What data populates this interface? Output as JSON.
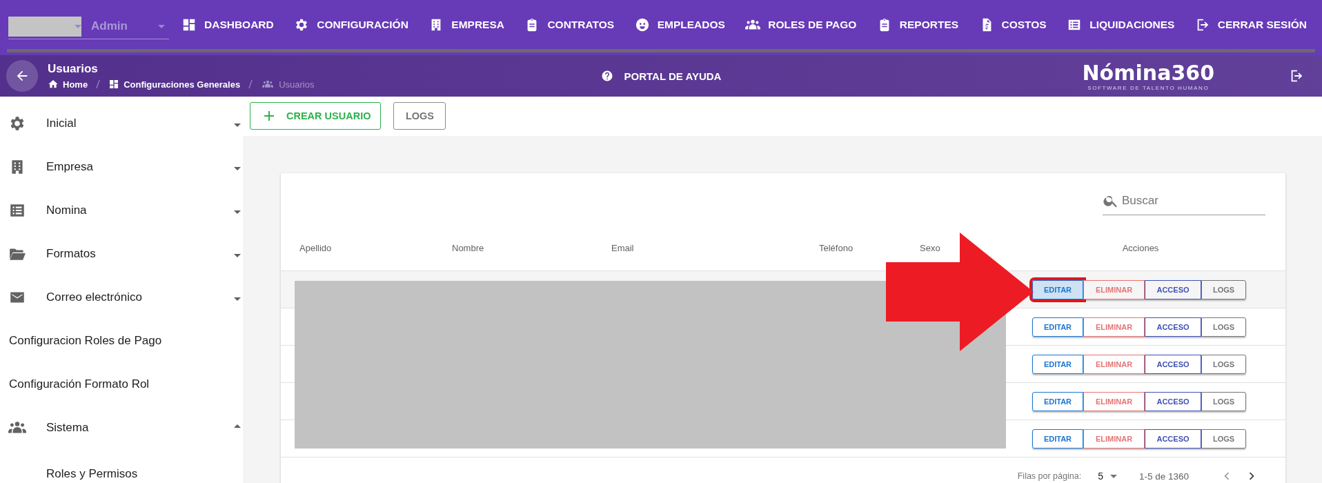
{
  "top_nav": {
    "user_select": {
      "value": "Admin"
    },
    "items": [
      {
        "label": "DASHBOARD"
      },
      {
        "label": "CONFIGURACIÓN"
      },
      {
        "label": "EMPRESA"
      },
      {
        "label": "CONTRATOS"
      },
      {
        "label": "EMPLEADOS"
      },
      {
        "label": "ROLES DE PAGO"
      },
      {
        "label": "REPORTES"
      },
      {
        "label": "COSTOS"
      },
      {
        "label": "LIQUIDACIONES"
      },
      {
        "label": "CERRAR SESIÓN"
      }
    ]
  },
  "header": {
    "title": "Usuarios",
    "breadcrumb": [
      "Home",
      "Configuraciones Generales",
      "Usuarios"
    ],
    "help_link": "PORTAL DE AYUDA",
    "logo": {
      "name": "Nómina360",
      "tagline": "SOFTWARE DE TALENTO HUMANO"
    }
  },
  "sidebar": {
    "items": [
      {
        "kind": "group",
        "label": "Inicial",
        "expanded": false
      },
      {
        "kind": "group",
        "label": "Empresa",
        "expanded": false
      },
      {
        "kind": "group",
        "label": "Nomina",
        "expanded": false
      },
      {
        "kind": "group",
        "label": "Formatos",
        "expanded": false
      },
      {
        "kind": "group",
        "label": "Correo electrónico",
        "expanded": false
      },
      {
        "kind": "link",
        "label": "Configuracion Roles de Pago"
      },
      {
        "kind": "link",
        "label": "Configuración Formato Rol"
      },
      {
        "kind": "group",
        "label": "Sistema",
        "expanded": true,
        "children": [
          {
            "label": "Roles y Permisos"
          }
        ]
      }
    ]
  },
  "toolbar": {
    "buttons": [
      {
        "label": "CREAR USUARIO",
        "kind": "create"
      },
      {
        "label": "LOGS",
        "kind": "plain"
      }
    ]
  },
  "table": {
    "search": {
      "placeholder": "Buscar"
    },
    "columns": [
      "Apellido",
      "Nombre",
      "Email",
      "Teléfono",
      "Sexo",
      "Acciones"
    ],
    "rows": [
      {
        "highlighted": true,
        "marked": true,
        "actions": [
          {
            "label": "EDITAR",
            "kind": "edit"
          },
          {
            "label": "ELIMINAR",
            "kind": "delete"
          },
          {
            "label": "ACCESO",
            "kind": "access"
          },
          {
            "label": "LOGS",
            "kind": "logs"
          }
        ]
      },
      {
        "highlighted": false,
        "marked": false,
        "actions": [
          {
            "label": "EDITAR",
            "kind": "edit"
          },
          {
            "label": "ELIMINAR",
            "kind": "delete"
          },
          {
            "label": "ACCESO",
            "kind": "access"
          },
          {
            "label": "LOGS",
            "kind": "logs"
          }
        ]
      },
      {
        "highlighted": false,
        "marked": false,
        "actions": [
          {
            "label": "EDITAR",
            "kind": "edit"
          },
          {
            "label": "ELIMINAR",
            "kind": "delete"
          },
          {
            "label": "ACCESO",
            "kind": "access"
          },
          {
            "label": "LOGS",
            "kind": "logs"
          }
        ]
      },
      {
        "highlighted": false,
        "marked": false,
        "actions": [
          {
            "label": "EDITAR",
            "kind": "edit"
          },
          {
            "label": "ELIMINAR",
            "kind": "delete"
          },
          {
            "label": "ACCESO",
            "kind": "access"
          },
          {
            "label": "LOGS",
            "kind": "logs"
          }
        ]
      },
      {
        "highlighted": false,
        "marked": false,
        "actions": [
          {
            "label": "EDITAR",
            "kind": "edit"
          },
          {
            "label": "ELIMINAR",
            "kind": "delete"
          },
          {
            "label": "ACCESO",
            "kind": "access"
          },
          {
            "label": "LOGS",
            "kind": "logs"
          }
        ]
      }
    ],
    "pagination": {
      "rows_label": "Filas por página:",
      "rows_per_page": "5",
      "range": "1-5 de 1360"
    }
  }
}
